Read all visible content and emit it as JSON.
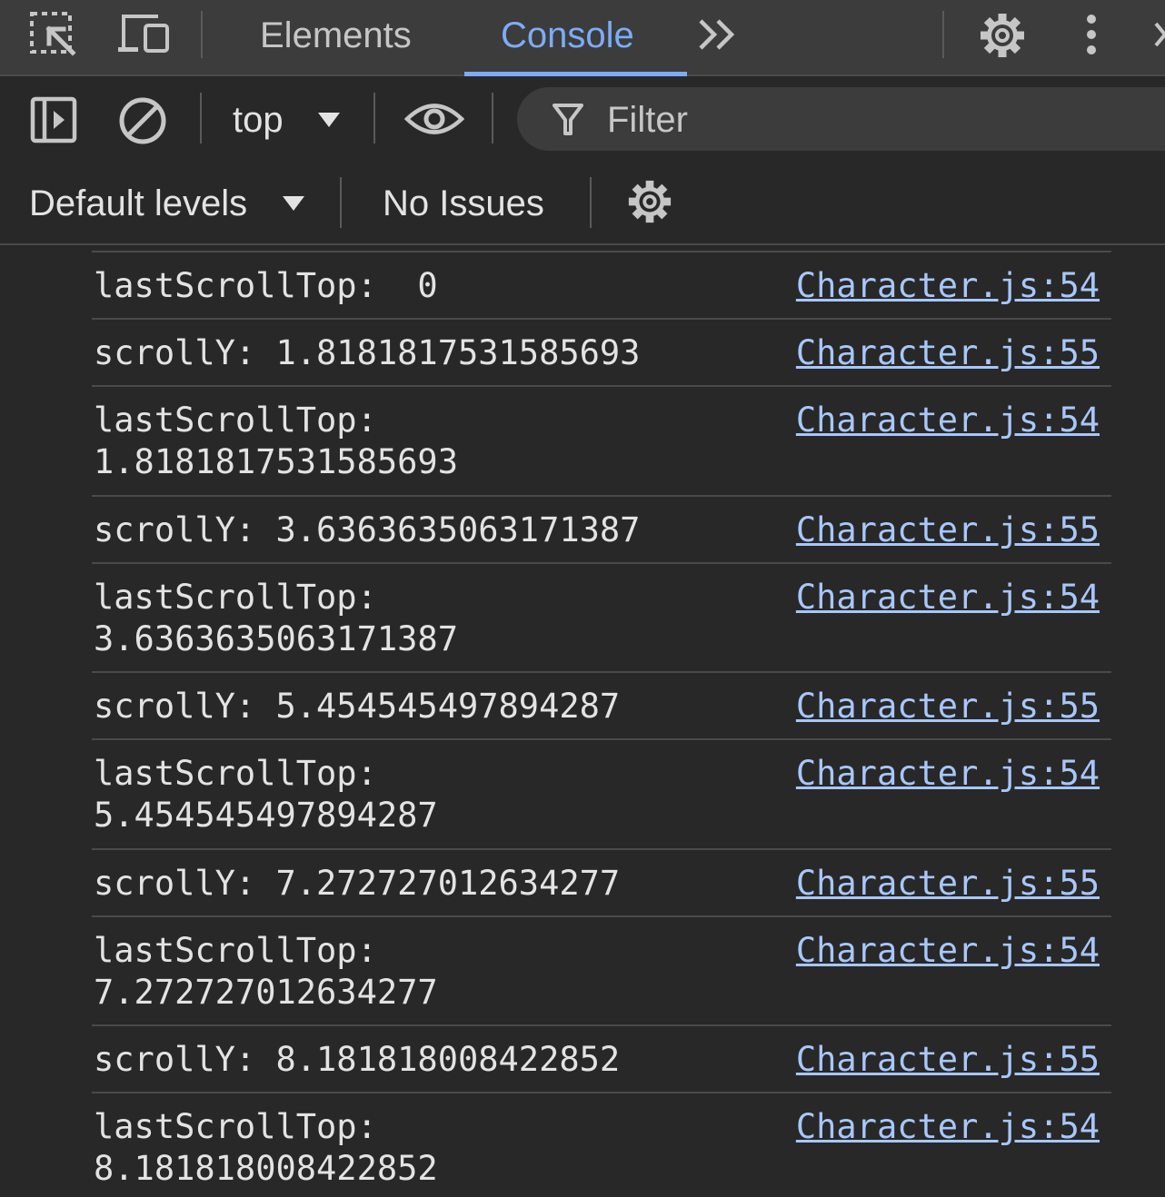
{
  "tabs": {
    "elements": "Elements",
    "console": "Console",
    "more": "»"
  },
  "toolbar": {
    "context": "top",
    "filter_placeholder": "Filter",
    "levels": "Default levels",
    "issues": "No Issues"
  },
  "icons": [
    "inspect-element-icon",
    "device-toolbar-icon",
    "more-tabs-icon",
    "settings-gear-icon",
    "kebab-menu-icon",
    "close-icon",
    "sidebar-toggle-icon",
    "clear-console-icon",
    "dropdown-caret-icon",
    "live-expression-eye-icon",
    "filter-funnel-icon",
    "console-settings-gear-icon"
  ],
  "colors": {
    "background": "#282828",
    "toolbar": "#3c3c3c",
    "accent": "#7cacf8",
    "link": "#a8c7fa",
    "text": "#e3e3e3"
  },
  "logs": [
    {
      "message": "lastScrollTop:  0",
      "source": "Character.js:54"
    },
    {
      "message": "scrollY: 1.8181817531585693",
      "source": "Character.js:55"
    },
    {
      "message": "lastScrollTop:\n1.8181817531585693",
      "source": "Character.js:54"
    },
    {
      "message": "scrollY: 3.6363635063171387",
      "source": "Character.js:55"
    },
    {
      "message": "lastScrollTop:\n3.6363635063171387",
      "source": "Character.js:54"
    },
    {
      "message": "scrollY: 5.454545497894287",
      "source": "Character.js:55"
    },
    {
      "message": "lastScrollTop:\n5.454545497894287",
      "source": "Character.js:54"
    },
    {
      "message": "scrollY: 7.272727012634277",
      "source": "Character.js:55"
    },
    {
      "message": "lastScrollTop:\n7.272727012634277",
      "source": "Character.js:54"
    },
    {
      "message": "scrollY: 8.181818008422852",
      "source": "Character.js:55"
    },
    {
      "message": "lastScrollTop:\n8.181818008422852",
      "source": "Character.js:54"
    }
  ]
}
